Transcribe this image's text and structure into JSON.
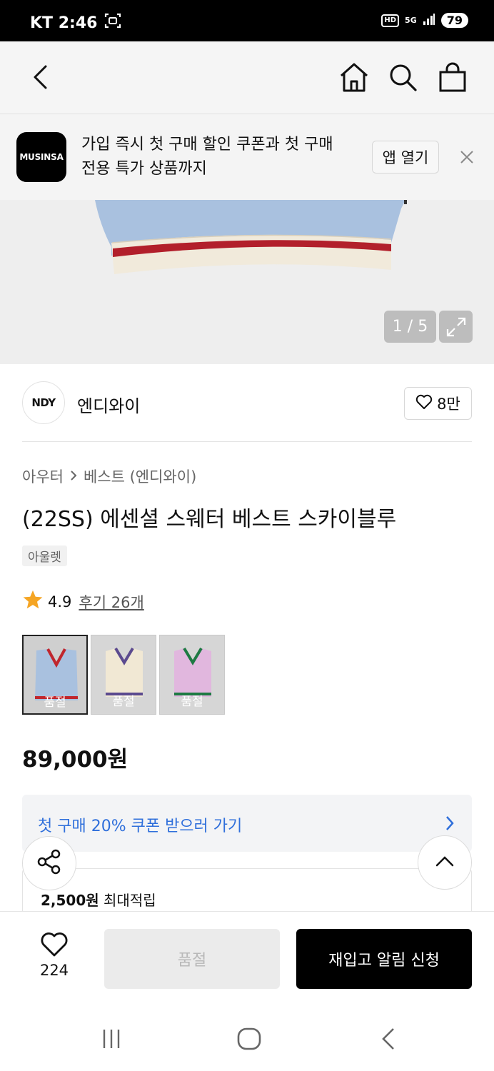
{
  "status_bar": {
    "carrier_time": "KT 2:46",
    "hd": "HD",
    "network": "5G",
    "battery": "79"
  },
  "nav": {
    "back_icon": "back-icon",
    "home_icon": "home-icon",
    "search_icon": "search-icon",
    "cart_icon": "cart-icon"
  },
  "app_banner": {
    "logo": "MUSINSA",
    "text_line1": "가입 즉시 첫 구매 할인 쿠폰과 첫 구매",
    "text_line2": "전용 특가 상품까지",
    "open_label": "앱 열기"
  },
  "gallery": {
    "counter": "1 / 5"
  },
  "brand": {
    "logo": "NDY",
    "name": "엔디와이",
    "likes": "8만"
  },
  "breadcrumb": {
    "category": "아우터",
    "subcategory": "베스트 (엔디와이)"
  },
  "product": {
    "title": "(22SS) 에센셜 스웨터 베스트 스카이블루",
    "tag": "아울렛",
    "rating": "4.9",
    "reviews": "후기 26개",
    "price": "89,000원"
  },
  "options": [
    {
      "soldout": "품절",
      "body_color": "#a9c1df",
      "trim_color": "#c0262d"
    },
    {
      "soldout": "품절",
      "body_color": "#f1e8d4",
      "trim_color": "#5b4a8f"
    },
    {
      "soldout": "품절",
      "body_color": "#e1b7de",
      "trim_color": "#1e7a43"
    }
  ],
  "coupon": {
    "text": "첫 구매 20% 쿠폰 받으러 가기"
  },
  "points": {
    "amount": "2,500원",
    "label": "최대적립"
  },
  "bottom_bar": {
    "wish_count": "224",
    "soldout_label": "품절",
    "restock_label": "재입고 알림 신청"
  },
  "colors": {
    "accent_blue": "#2f6fdb",
    "star": "#f5a524"
  }
}
